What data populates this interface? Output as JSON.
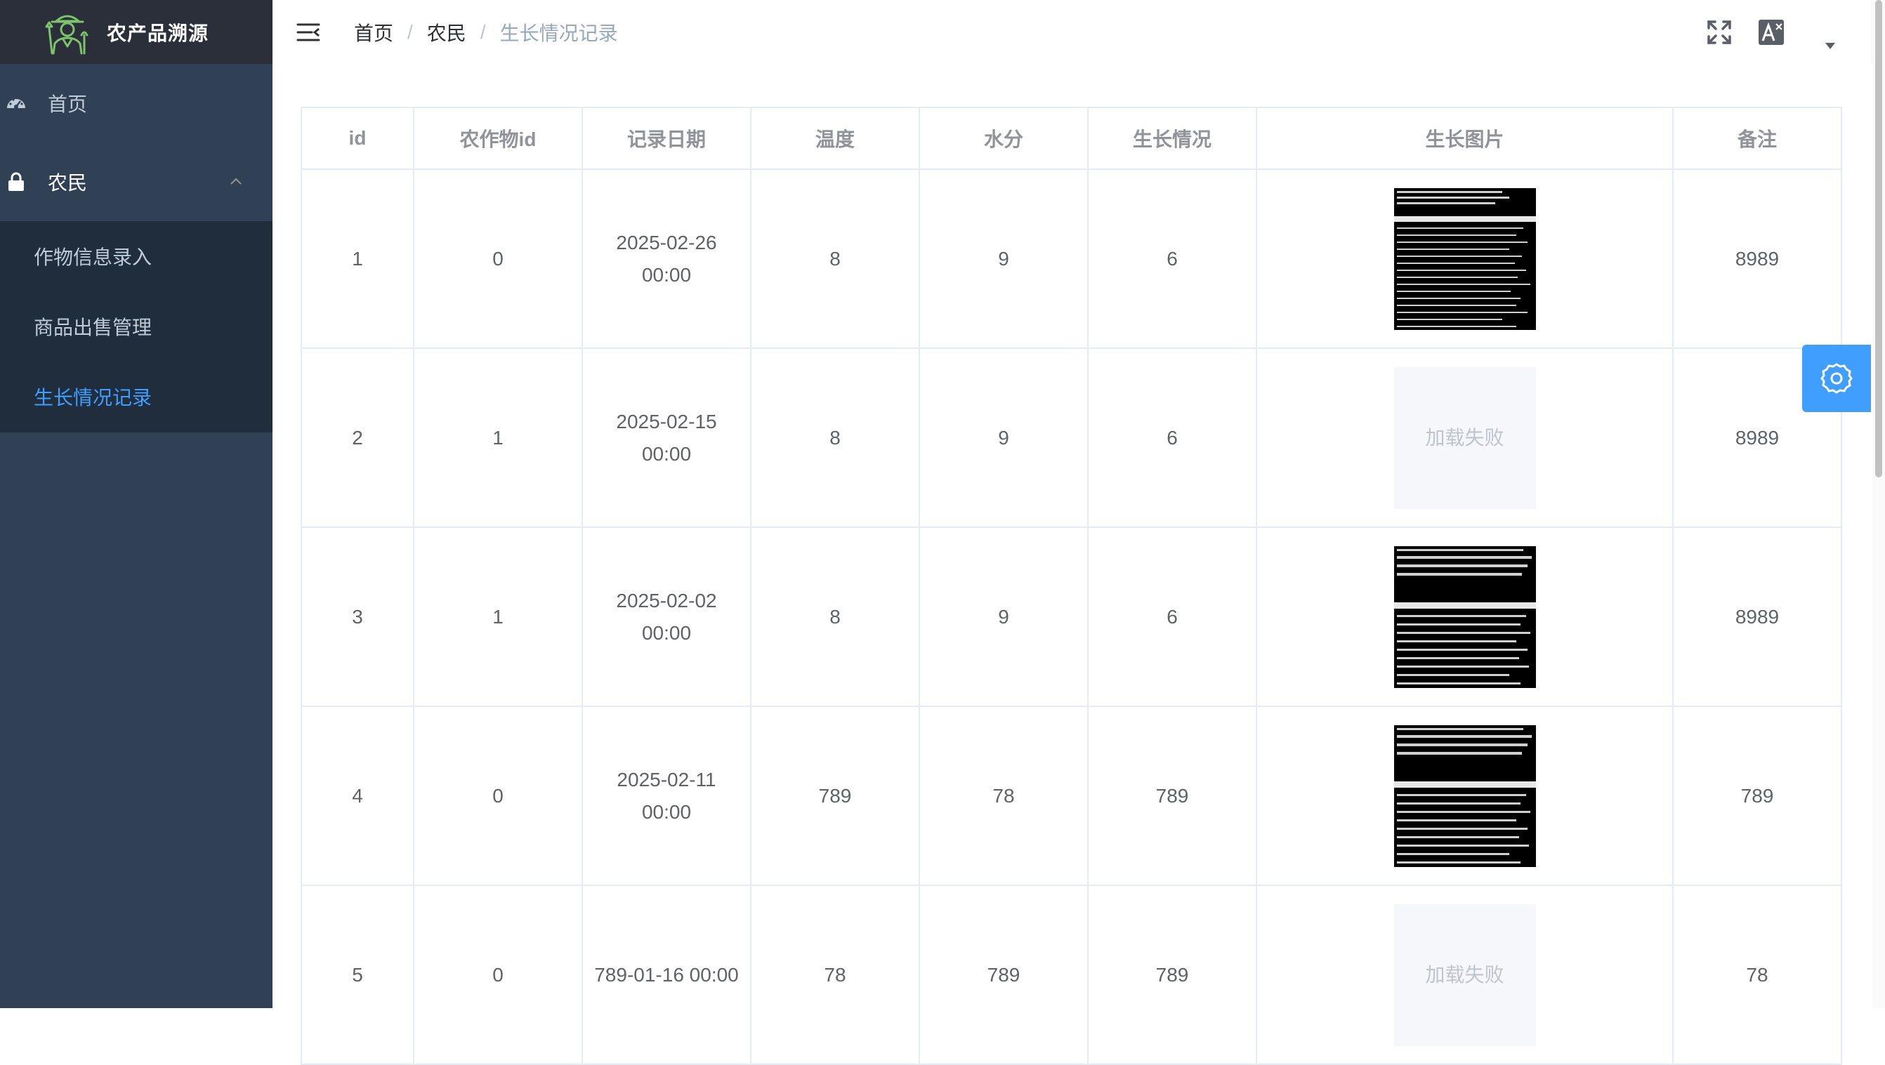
{
  "app": {
    "title": "农产品溯源",
    "logo_icon": "farmer-logo-icon"
  },
  "sidebar": {
    "home": {
      "label": "首页",
      "icon": "dashboard-icon"
    },
    "farmer": {
      "label": "农民",
      "icon": "lock-icon",
      "expanded": true,
      "children": [
        {
          "label": "作物信息录入",
          "active": false
        },
        {
          "label": "商品出售管理",
          "active": false
        },
        {
          "label": "生长情况记录",
          "active": true
        }
      ]
    }
  },
  "navbar": {
    "breadcrumb": [
      "首页",
      "农民",
      "生长情况记录"
    ],
    "separator": "/",
    "icons": [
      "hamburger-icon",
      "fullscreen-icon",
      "translate-icon",
      "caret-down-icon"
    ]
  },
  "table": {
    "columns": [
      "id",
      "农作物id",
      "记录日期",
      "温度",
      "水分",
      "生长情况",
      "生长图片",
      "备注"
    ],
    "rows": [
      {
        "id": "1",
        "crop_id": "0",
        "date": "2025-02-26 00:00",
        "temperature": "8",
        "moisture": "9",
        "growth": "6",
        "image": "screenshot",
        "note": "8989"
      },
      {
        "id": "2",
        "crop_id": "1",
        "date": "2025-02-15 00:00",
        "temperature": "8",
        "moisture": "9",
        "growth": "6",
        "image": "failed",
        "note": "8989"
      },
      {
        "id": "3",
        "crop_id": "1",
        "date": "2025-02-02 00:00",
        "temperature": "8",
        "moisture": "9",
        "growth": "6",
        "image": "screenshot",
        "note": "8989"
      },
      {
        "id": "4",
        "crop_id": "0",
        "date": "2025-02-11 00:00",
        "temperature": "789",
        "moisture": "78",
        "growth": "789",
        "image": "screenshot",
        "note": "789"
      },
      {
        "id": "5",
        "crop_id": "0",
        "date": "789-01-16 00:00",
        "temperature": "78",
        "moisture": "789",
        "growth": "789",
        "image": "failed",
        "note": "78"
      }
    ],
    "image_failed_text": "加载失败"
  },
  "settings": {
    "icon": "gear-icon"
  },
  "colors": {
    "sidebar_bg": "#304156",
    "logo_bg": "#2b2f3a",
    "submenu_bg": "#1f2d3d",
    "accent": "#409eff"
  }
}
